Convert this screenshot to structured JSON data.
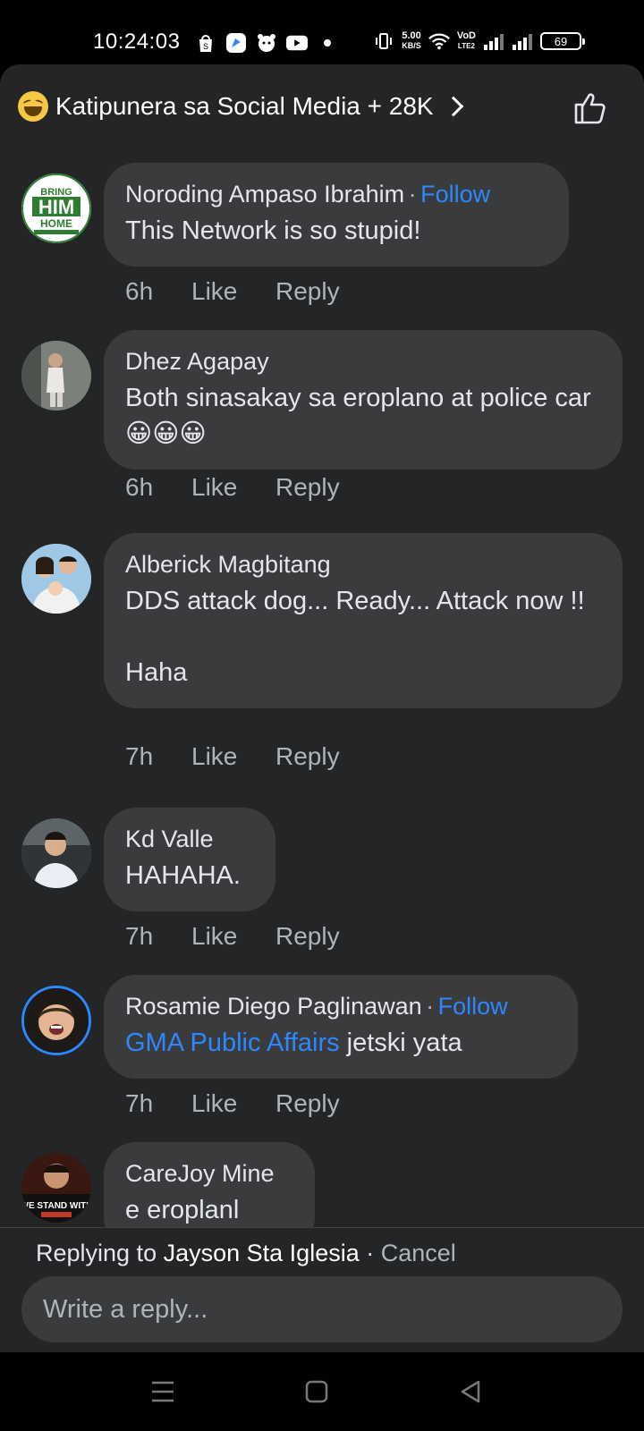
{
  "status_bar": {
    "time": "10:24:03",
    "net_speed_value": "5.00",
    "net_speed_unit": "KB/S",
    "network_label_top": "VoD",
    "network_label_bottom": "LTE2",
    "battery": "69",
    "icons": [
      "shopee-icon",
      "browser-icon",
      "pet-app-icon",
      "youtube-icon",
      "dot-icon",
      "vibrate-icon",
      "wifi-icon",
      "signal-icon",
      "signal-icon",
      "battery-icon"
    ]
  },
  "header": {
    "reaction_icon": "laughing-emoji-icon",
    "title": "Katipunera sa Social Media + 28K",
    "like_icon": "thumbs-up-outline-icon"
  },
  "comments": [
    {
      "author": "Noroding Ampaso Ibrahim",
      "separator": "·",
      "follow": "Follow",
      "text": "This Network is so stupid!",
      "time": "6h",
      "like": "Like",
      "reply": "Reply"
    },
    {
      "author": "Dhez Agapay",
      "text": "Both sinasakay sa eroplano at police car😀😀😀",
      "time": "6h",
      "like": "Like",
      "reply": "Reply"
    },
    {
      "author": "Alberick Magbitang",
      "text": "DDS attack dog... Ready... Attack now !!\n\nHaha",
      "time": "7h",
      "like": "Like",
      "reply": "Reply"
    },
    {
      "author": "Kd Valle",
      "text": "HAHAHA.",
      "time": "7h",
      "like": "Like",
      "reply": "Reply"
    },
    {
      "author": "Rosamie Diego Paglinawan",
      "separator": "·",
      "follow": "Follow",
      "mention": "GMA Public Affairs",
      "text": " jetski yata",
      "time": "7h",
      "like": "Like",
      "reply": "Reply"
    },
    {
      "author": "CareJoy Mine",
      "text": "e eroplanl"
    }
  ],
  "avatar_texts": {
    "bring": "BRING",
    "him": "HIM",
    "home": "HOME",
    "we_stand": "WE STAND WITH"
  },
  "reply_bar": {
    "replying_prefix": "Replying to ",
    "replying_name": "Jayson Sta Iglesia",
    "separator": " · ",
    "cancel": "Cancel",
    "placeholder": "Write a reply..."
  },
  "nav": {
    "icons": [
      "menu-icon",
      "home-square-icon",
      "back-triangle-icon"
    ]
  },
  "colors": {
    "background": "#242526",
    "bubble": "#3a3b3c",
    "link": "#2d88ff",
    "muted": "#b0b3b8"
  }
}
